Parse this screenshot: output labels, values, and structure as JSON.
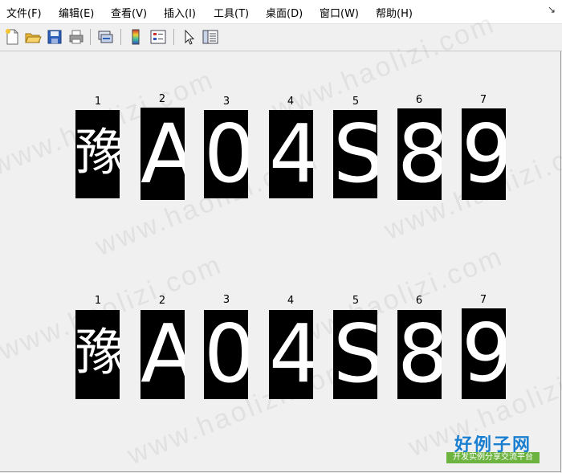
{
  "menu": {
    "items": [
      "文件(F)",
      "编辑(E)",
      "查看(V)",
      "插入(I)",
      "工具(T)",
      "桌面(D)",
      "窗口(W)",
      "帮助(H)"
    ]
  },
  "toolbar": {
    "buttons": [
      "new-icon",
      "open-icon",
      "save-icon",
      "print-icon",
      "link-icon",
      "colorbar-icon",
      "legend-icon",
      "pointer-icon",
      "property-inspector-icon"
    ]
  },
  "figure": {
    "rows": [
      {
        "labels": [
          "1",
          "2",
          "3",
          "4",
          "5",
          "6",
          "7"
        ],
        "chars": [
          "豫",
          "A",
          "0",
          "4",
          "S",
          "8",
          "9"
        ]
      },
      {
        "labels": [
          "1",
          "2",
          "3",
          "4",
          "5",
          "6",
          "7"
        ],
        "chars": [
          "豫",
          "A",
          "0",
          "4",
          "S",
          "8",
          "9"
        ]
      }
    ]
  },
  "watermark": "www.haolizi.com",
  "logo": {
    "main": "好例子网",
    "sub": "开发实例分享交流平台"
  }
}
